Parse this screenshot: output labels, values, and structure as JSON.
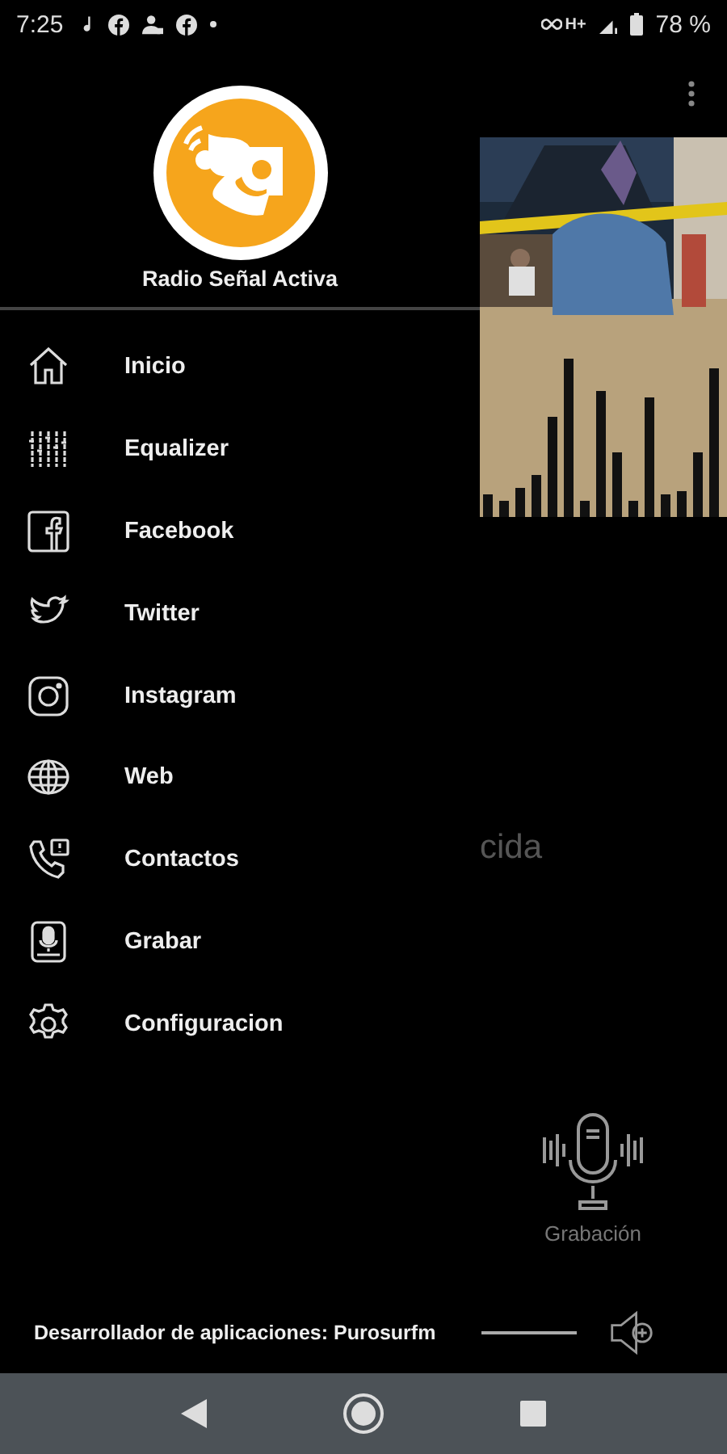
{
  "status_bar": {
    "time": "7:25",
    "network": "H+",
    "battery": "78 %"
  },
  "drawer": {
    "app_name": "Radio Señal Activa",
    "items": [
      {
        "label": "Inicio",
        "kind": "home"
      },
      {
        "label": "Equalizer",
        "kind": "equalizer"
      },
      {
        "label": "Facebook",
        "kind": "facebook"
      },
      {
        "label": "Twitter",
        "kind": "twitter"
      },
      {
        "label": "Instagram",
        "kind": "instagram"
      },
      {
        "label": "Web",
        "kind": "web"
      },
      {
        "label": "Contactos",
        "kind": "contacts"
      },
      {
        "label": "Grabar",
        "kind": "record"
      },
      {
        "label": "Configuracion",
        "kind": "settings"
      }
    ]
  },
  "main": {
    "partial_text": "cida",
    "record_label": "Grabación"
  },
  "footer": {
    "credit": "Desarrollador de aplicaciones: Purosurfm",
    "volume": {
      "level": 1
    }
  }
}
